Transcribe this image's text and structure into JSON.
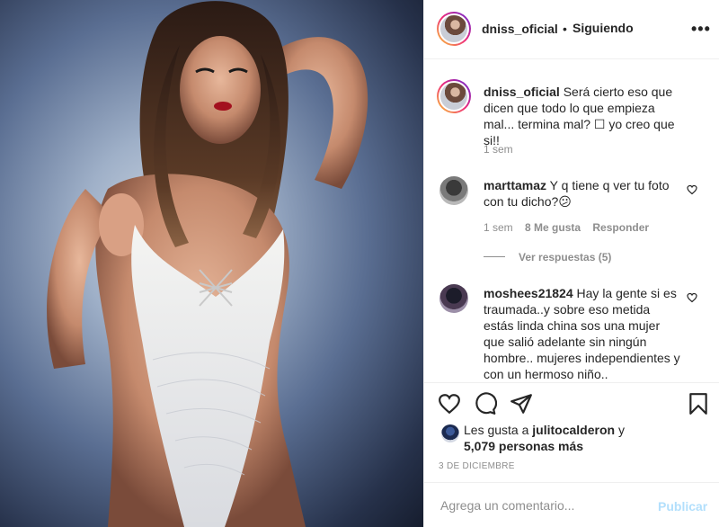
{
  "post": {
    "image_alt": "Foto de la publicación"
  },
  "header": {
    "username": "dniss_oficial",
    "separator": "•",
    "follow_status": "Siguiendo",
    "more_icon": "more-horizontal-icon"
  },
  "caption": {
    "username": "dniss_oficial",
    "text": "Será cierto eso que dicen que todo lo que empieza mal... termina mal? ☐ yo creo que si!!",
    "time": "1 sem"
  },
  "comments": [
    {
      "username": "marttamaz",
      "text": "Y q tiene q ver tu foto con tu dicho?😕",
      "time": "1 sem",
      "likes": "8 Me gusta",
      "reply_label": "Responder",
      "view_replies": "Ver respuestas (5)"
    },
    {
      "username": "moshees21824",
      "text": "Hay la gente si es traumada..y sobre eso metida estás linda china sos una mujer que salió adelante sin ningún hombre.. mujeres independientes y con un hermoso niño.."
    }
  ],
  "actions": {
    "like_icon": "heart-icon",
    "comment_icon": "comment-icon",
    "share_icon": "share-icon",
    "save_icon": "bookmark-icon"
  },
  "likes": {
    "prefix": "Les gusta a",
    "user": "julitocalderon",
    "connector": "y",
    "others": "5,079 personas más"
  },
  "date": "3 DE DICIEMBRE",
  "add_comment": {
    "placeholder": "Agrega un comentario...",
    "publish_label": "Publicar"
  },
  "colors": {
    "text": "#262626",
    "muted": "#8e8e8e",
    "publish_disabled": "#b2dffc",
    "border": "#efefef"
  }
}
